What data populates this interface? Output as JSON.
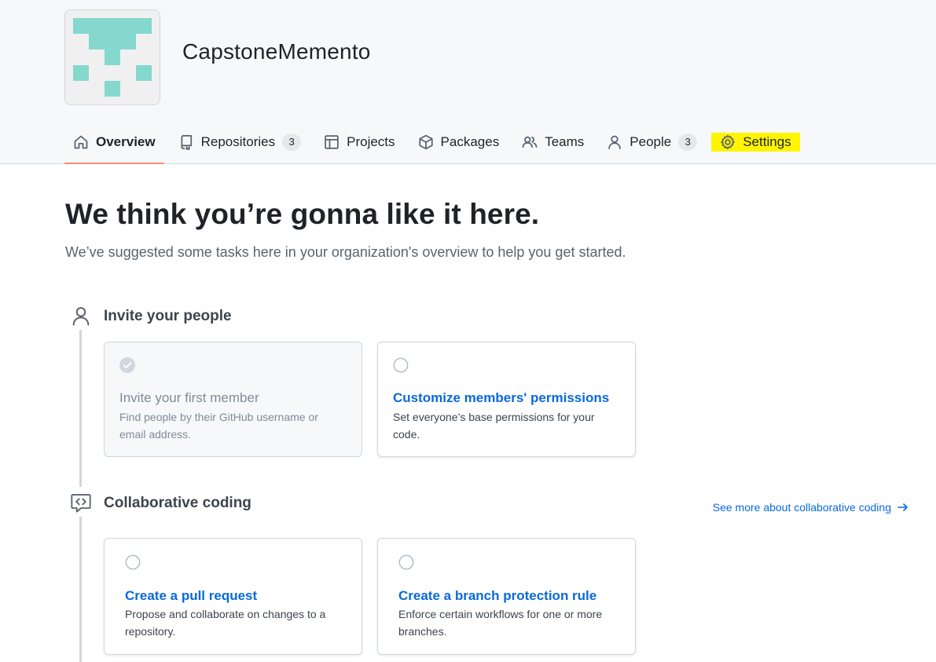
{
  "org": {
    "name": "CapstoneMemento",
    "avatar_color": "#85d8ce"
  },
  "nav": {
    "overview": {
      "label": "Overview"
    },
    "repositories": {
      "label": "Repositories",
      "count": "3"
    },
    "projects": {
      "label": "Projects"
    },
    "packages": {
      "label": "Packages"
    },
    "teams": {
      "label": "Teams"
    },
    "people": {
      "label": "People",
      "count": "3"
    },
    "settings": {
      "label": "Settings",
      "highlight_color": "#fff500"
    }
  },
  "hero": {
    "title": "We think you’re gonna like it here.",
    "subtitle": "We’ve suggested some tasks here in your organization's overview to help you get started."
  },
  "sections": {
    "invite": {
      "title": "Invite your people",
      "icon": "person-icon",
      "cards": [
        {
          "title": "Invite your first member",
          "description": "Find people by their GitHub username or email address.",
          "completed": true
        },
        {
          "title": "Customize members' permissions",
          "description": "Set everyone’s base permissions for your code.",
          "completed": false
        }
      ]
    },
    "collab": {
      "title": "Collaborative coding",
      "icon": "code-review-icon",
      "see_more": "See more about collaborative coding",
      "cards": [
        {
          "title": "Create a pull request",
          "description": "Propose and collaborate on changes to a repository.",
          "completed": false
        },
        {
          "title": "Create a branch protection rule",
          "description": "Enforce certain workflows for one or more branches.",
          "completed": false
        }
      ]
    }
  },
  "colors": {
    "link": "#0969da",
    "selected_underline": "#fd8c73"
  }
}
